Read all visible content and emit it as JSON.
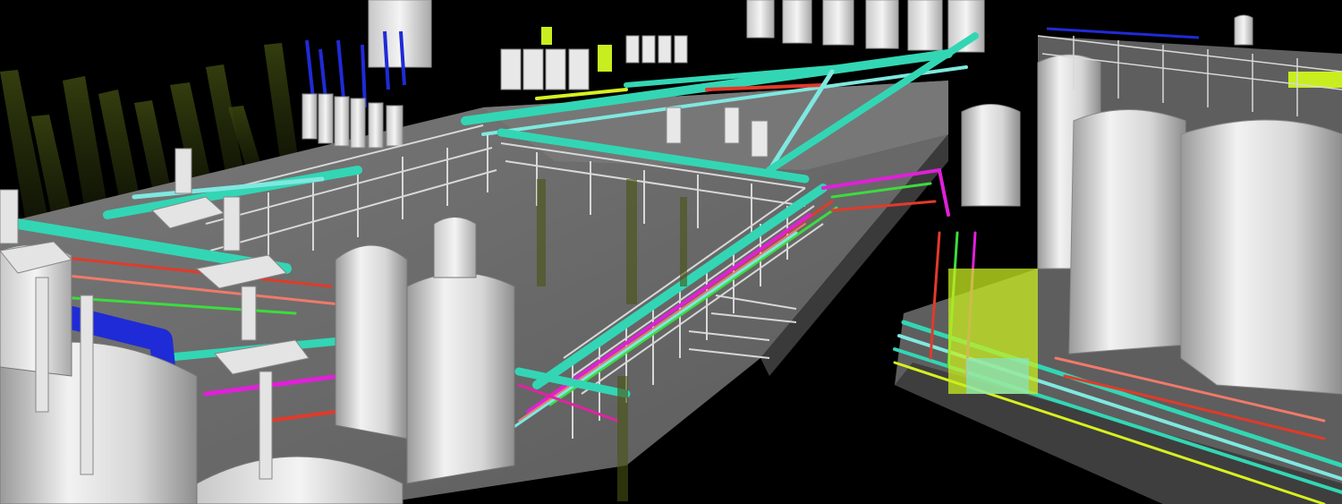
{
  "scene": {
    "kind": "3D plant piping model render",
    "background": "#000000",
    "colors": {
      "floor": "#6e6e6e",
      "floor_dark": "#4a4a4a",
      "vessel": "#e6e6e6",
      "vessel_shade": "#b9b9b9",
      "pipe_teal": "#33d6b4",
      "pipe_cyan": "#7fe8e0",
      "pipe_blue": "#1f2bd6",
      "pipe_magenta": "#e020d8",
      "pipe_red": "#e23a2a",
      "pipe_green": "#3ddc3d",
      "pipe_yellow": "#d8f020",
      "pipe_salmon": "#f07a6a",
      "steel": "#d0d0d0",
      "ghost_column": "#6b7a1a"
    }
  }
}
